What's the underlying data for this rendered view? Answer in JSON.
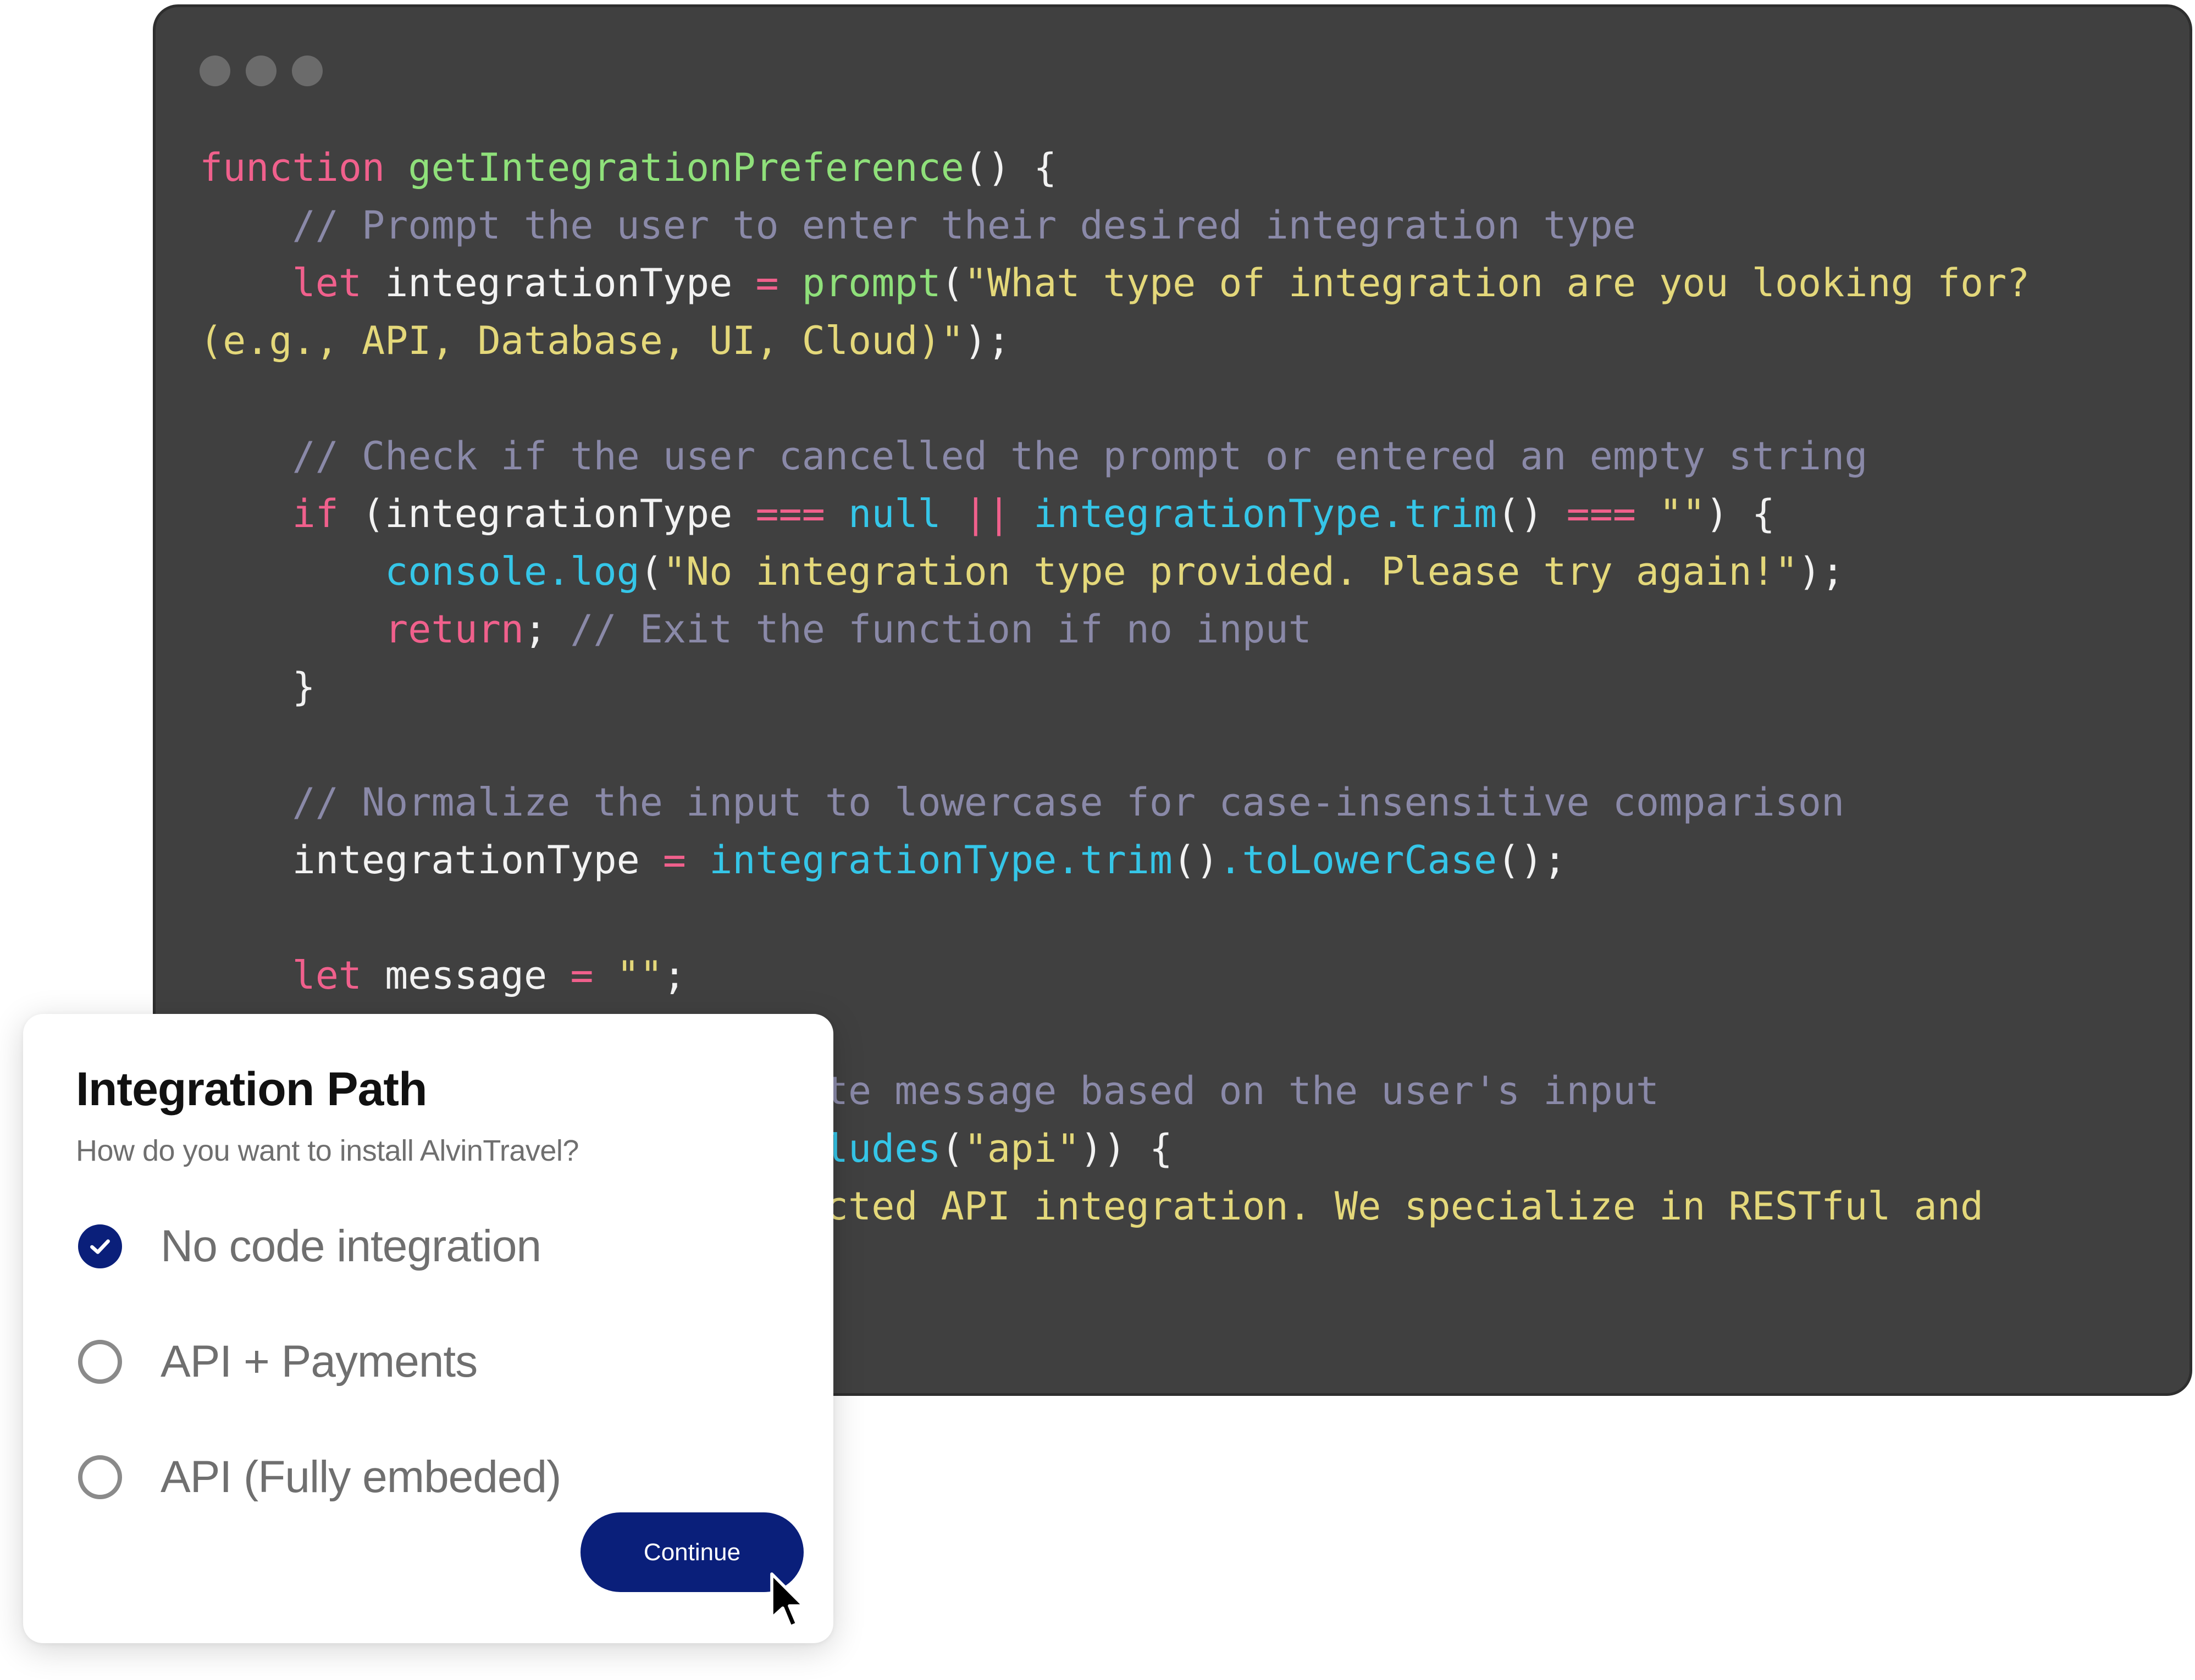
{
  "editor": {
    "window_dots": [
      "dot",
      "dot",
      "dot"
    ],
    "lines": [
      [
        {
          "t": "function",
          "c": "keyword"
        },
        {
          "t": " ",
          "c": "ident"
        },
        {
          "t": "getIntegrationPreference",
          "c": "fn"
        },
        {
          "t": "() {",
          "c": "punct"
        }
      ],
      [
        {
          "t": "    ",
          "c": "ident"
        },
        {
          "t": "// Prompt the user to enter their desired integration type",
          "c": "comment"
        }
      ],
      [
        {
          "t": "    ",
          "c": "ident"
        },
        {
          "t": "let",
          "c": "keyword"
        },
        {
          "t": " integrationType ",
          "c": "ident"
        },
        {
          "t": "=",
          "c": "op"
        },
        {
          "t": " ",
          "c": "ident"
        },
        {
          "t": "prompt",
          "c": "fn"
        },
        {
          "t": "(",
          "c": "punct"
        },
        {
          "t": "\"What type of integration are you looking for?",
          "c": "string"
        }
      ],
      [
        {
          "t": "(e.g., API, Database, UI, Cloud)\"",
          "c": "string"
        },
        {
          "t": ");",
          "c": "punct"
        }
      ],
      [],
      [
        {
          "t": "    ",
          "c": "ident"
        },
        {
          "t": "// Check if the user cancelled the prompt or entered an empty string",
          "c": "comment"
        }
      ],
      [
        {
          "t": "    ",
          "c": "ident"
        },
        {
          "t": "if",
          "c": "keyword"
        },
        {
          "t": " (integrationType ",
          "c": "ident"
        },
        {
          "t": "===",
          "c": "op"
        },
        {
          "t": " ",
          "c": "ident"
        },
        {
          "t": "null",
          "c": "method"
        },
        {
          "t": " ",
          "c": "ident"
        },
        {
          "t": "||",
          "c": "op"
        },
        {
          "t": " ",
          "c": "ident"
        },
        {
          "t": "integrationType.trim",
          "c": "method"
        },
        {
          "t": "() ",
          "c": "punct"
        },
        {
          "t": "===",
          "c": "op"
        },
        {
          "t": " ",
          "c": "ident"
        },
        {
          "t": "\"\"",
          "c": "string"
        },
        {
          "t": ") {",
          "c": "punct"
        }
      ],
      [
        {
          "t": "        ",
          "c": "ident"
        },
        {
          "t": "console.log",
          "c": "method"
        },
        {
          "t": "(",
          "c": "punct"
        },
        {
          "t": "\"No integration type provided. Please try again!\"",
          "c": "string"
        },
        {
          "t": ");",
          "c": "punct"
        }
      ],
      [
        {
          "t": "        ",
          "c": "ident"
        },
        {
          "t": "return",
          "c": "keyword"
        },
        {
          "t": "; ",
          "c": "punct"
        },
        {
          "t": "// Exit the function if no input",
          "c": "comment"
        }
      ],
      [
        {
          "t": "    }",
          "c": "punct"
        }
      ],
      [],
      [
        {
          "t": "    ",
          "c": "ident"
        },
        {
          "t": "// Normalize the input to lowercase for case-insensitive comparison",
          "c": "comment"
        }
      ],
      [
        {
          "t": "    integrationType ",
          "c": "ident"
        },
        {
          "t": "=",
          "c": "op"
        },
        {
          "t": " ",
          "c": "ident"
        },
        {
          "t": "integrationType.trim",
          "c": "method"
        },
        {
          "t": "()",
          "c": "punct"
        },
        {
          "t": ".toLowerCase",
          "c": "method"
        },
        {
          "t": "();",
          "c": "punct"
        }
      ],
      [],
      [
        {
          "t": "    ",
          "c": "ident"
        },
        {
          "t": "let",
          "c": "keyword"
        },
        {
          "t": " message ",
          "c": "ident"
        },
        {
          "t": "=",
          "c": "op"
        },
        {
          "t": " ",
          "c": "ident"
        },
        {
          "t": "\"\"",
          "c": "string"
        },
        {
          "t": ";",
          "c": "punct"
        }
      ],
      [],
      [
        {
          "t": "    ",
          "c": "ident"
        },
        {
          "t": "// Provide an appropriate message based on the user's input",
          "c": "comment"
        }
      ],
      [
        {
          "t": "    ",
          "c": "ident"
        },
        {
          "t": "if",
          "c": "keyword"
        },
        {
          "t": " (integrationType.",
          "c": "ident"
        },
        {
          "t": "includes",
          "c": "method"
        },
        {
          "t": "(",
          "c": "punct"
        },
        {
          "t": "\"api\"",
          "c": "string"
        },
        {
          "t": ")) {",
          "c": "punct"
        }
      ],
      [
        {
          "t": "        message ",
          "c": "ident"
        },
        {
          "t": "=",
          "c": "op"
        },
        {
          "t": " ",
          "c": "ident"
        },
        {
          "t": "\"You selected API integration. We specialize in RESTful and",
          "c": "string"
        }
      ]
    ]
  },
  "dialog": {
    "title": "Integration Path",
    "subtitle": "How do you want to install AlvinTravel?",
    "options": [
      {
        "label": "No code integration",
        "checked": true
      },
      {
        "label": "API + Payments",
        "checked": false
      },
      {
        "label": "API (Fully embeded)",
        "checked": false
      }
    ],
    "continue_label": "Continue",
    "accent_color": "#0a1f7a"
  },
  "colors": {
    "editor_bg": "#404040",
    "keyword": "#f0608c",
    "function": "#8fe07a",
    "comment": "#8a89a8",
    "string": "#e4d87a",
    "method": "#35c6e8"
  },
  "icons": {
    "check": "check-icon",
    "cursor": "mouse-pointer-icon"
  }
}
